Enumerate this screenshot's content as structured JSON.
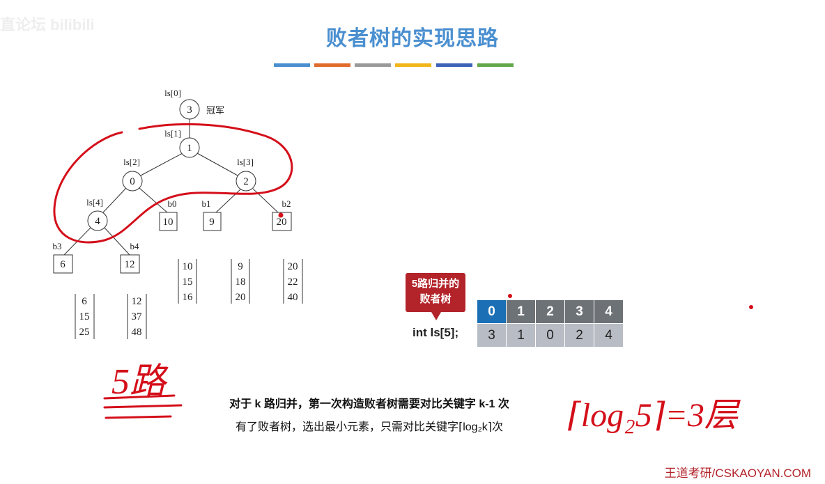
{
  "watermark": "直论坛 bilibili",
  "title": "败者树的实现思路",
  "title_bar_colors": [
    "#4a8fd0",
    "#e06c2c",
    "#9a9a9a",
    "#f2b51a",
    "#3d63b8",
    "#62a84a"
  ],
  "tree": {
    "nodes": [
      {
        "label": "ls[0]",
        "value": "3"
      },
      {
        "label": "ls[1]",
        "value": "1"
      },
      {
        "label": "ls[2]",
        "value": "0"
      },
      {
        "label": "ls[3]",
        "value": "2"
      },
      {
        "label": "ls[4]",
        "value": "4"
      }
    ],
    "champion": "冠军",
    "leaves": [
      {
        "label": "b0",
        "value": "10",
        "run": [
          "10",
          "15",
          "16"
        ]
      },
      {
        "label": "b1",
        "value": "9",
        "run": [
          "9",
          "18",
          "20"
        ]
      },
      {
        "label": "b2",
        "value": "20",
        "run": [
          "20",
          "22",
          "40"
        ]
      },
      {
        "label": "b3",
        "value": "6",
        "run": [
          "6",
          "15",
          "25"
        ]
      },
      {
        "label": "b4",
        "value": "12",
        "run": [
          "12",
          "37",
          "48"
        ]
      }
    ]
  },
  "callout": {
    "line1": "5路归并的",
    "line2": "败者树"
  },
  "array": {
    "label": "int ls[5];",
    "indices": [
      "0",
      "1",
      "2",
      "3",
      "4"
    ],
    "values": [
      "3",
      "1",
      "0",
      "2",
      "4"
    ]
  },
  "description": {
    "line1": "对于 k 路归并，第一次构造败者树需要对比关键字 k-1 次",
    "line2": "有了败者树，选出最小元素，只需对比关键字⌈log₂k⌉次"
  },
  "handwriting": {
    "left": "5路",
    "right": "⌈log₂5⌉=3层"
  },
  "footer": "王道考研/CSKAOYAN.COM"
}
